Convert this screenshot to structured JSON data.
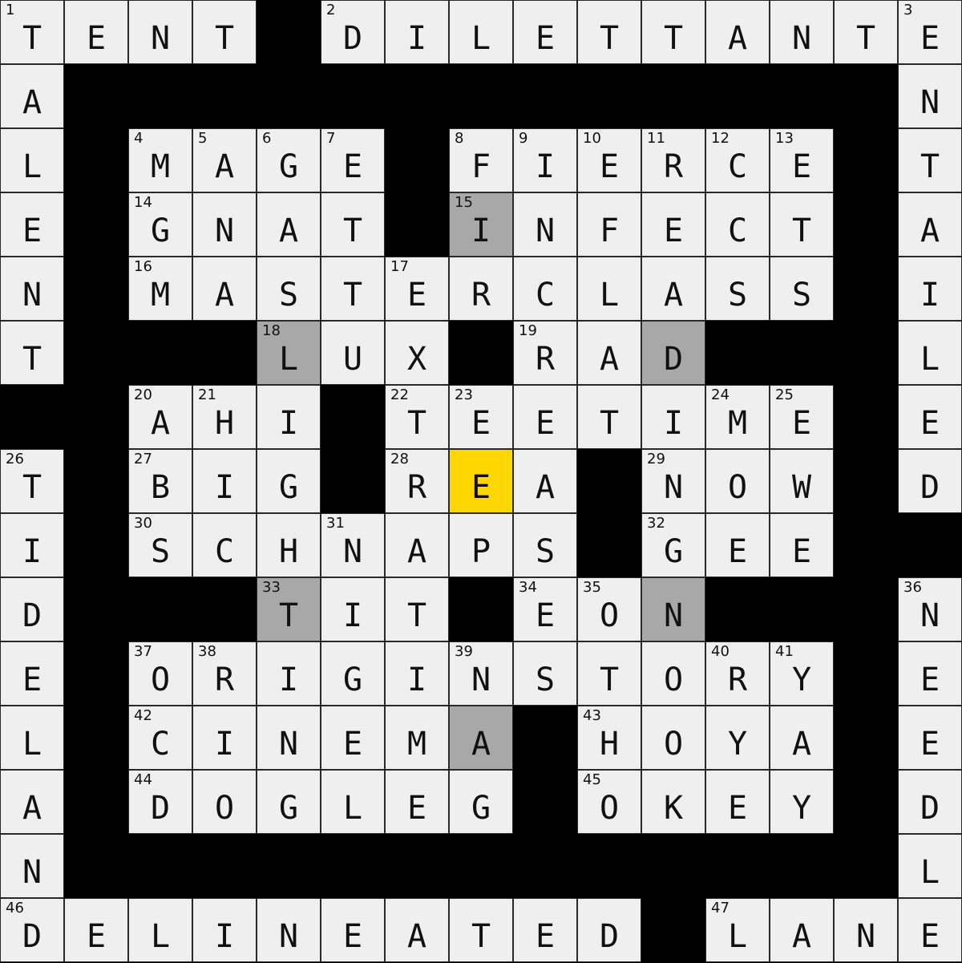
{
  "puzzle": {
    "size": 15,
    "grid": [
      "TENT#DILETTANTE",
      "A#############N",
      "L#MAGE#FIERCE#T",
      "E#GNAT#INFECT#A",
      "N#MASTERCLASS#I",
      "T###LUX#RAD###L",
      "##AHI#TEETIME#E",
      "T#BIG#REA#NOW#D",
      "I#SCHNAPS#GEE##",
      "D###TIT#EON###N",
      "E#ORIGINSTORY#E",
      "L#CINEMA#HOYA#E",
      "A#DOGLEG#OKEY#D",
      "N#############L",
      "DELINEATED#LANE"
    ],
    "numbers": [
      {
        "r": 0,
        "c": 0,
        "n": "1"
      },
      {
        "r": 0,
        "c": 5,
        "n": "2"
      },
      {
        "r": 0,
        "c": 14,
        "n": "3"
      },
      {
        "r": 2,
        "c": 2,
        "n": "4"
      },
      {
        "r": 2,
        "c": 3,
        "n": "5"
      },
      {
        "r": 2,
        "c": 4,
        "n": "6"
      },
      {
        "r": 2,
        "c": 5,
        "n": "7"
      },
      {
        "r": 2,
        "c": 7,
        "n": "8"
      },
      {
        "r": 2,
        "c": 8,
        "n": "9"
      },
      {
        "r": 2,
        "c": 9,
        "n": "10"
      },
      {
        "r": 2,
        "c": 10,
        "n": "11"
      },
      {
        "r": 2,
        "c": 11,
        "n": "12"
      },
      {
        "r": 2,
        "c": 12,
        "n": "13"
      },
      {
        "r": 3,
        "c": 2,
        "n": "14"
      },
      {
        "r": 3,
        "c": 7,
        "n": "15"
      },
      {
        "r": 4,
        "c": 2,
        "n": "16"
      },
      {
        "r": 4,
        "c": 6,
        "n": "17"
      },
      {
        "r": 5,
        "c": 4,
        "n": "18"
      },
      {
        "r": 5,
        "c": 8,
        "n": "19"
      },
      {
        "r": 6,
        "c": 2,
        "n": "20"
      },
      {
        "r": 6,
        "c": 3,
        "n": "21"
      },
      {
        "r": 6,
        "c": 6,
        "n": "22"
      },
      {
        "r": 6,
        "c": 7,
        "n": "23"
      },
      {
        "r": 6,
        "c": 11,
        "n": "24"
      },
      {
        "r": 6,
        "c": 12,
        "n": "25"
      },
      {
        "r": 7,
        "c": 0,
        "n": "26"
      },
      {
        "r": 7,
        "c": 2,
        "n": "27"
      },
      {
        "r": 7,
        "c": 6,
        "n": "28"
      },
      {
        "r": 7,
        "c": 10,
        "n": "29"
      },
      {
        "r": 8,
        "c": 2,
        "n": "30"
      },
      {
        "r": 8,
        "c": 5,
        "n": "31"
      },
      {
        "r": 8,
        "c": 10,
        "n": "32"
      },
      {
        "r": 9,
        "c": 4,
        "n": "33"
      },
      {
        "r": 9,
        "c": 8,
        "n": "34"
      },
      {
        "r": 9,
        "c": 9,
        "n": "35"
      },
      {
        "r": 9,
        "c": 14,
        "n": "36"
      },
      {
        "r": 10,
        "c": 2,
        "n": "37"
      },
      {
        "r": 10,
        "c": 3,
        "n": "38"
      },
      {
        "r": 10,
        "c": 7,
        "n": "39"
      },
      {
        "r": 10,
        "c": 11,
        "n": "40"
      },
      {
        "r": 10,
        "c": 12,
        "n": "41"
      },
      {
        "r": 11,
        "c": 2,
        "n": "42"
      },
      {
        "r": 11,
        "c": 9,
        "n": "43"
      },
      {
        "r": 12,
        "c": 2,
        "n": "44"
      },
      {
        "r": 12,
        "c": 9,
        "n": "45"
      },
      {
        "r": 14,
        "c": 0,
        "n": "46"
      },
      {
        "r": 14,
        "c": 11,
        "n": "47"
      }
    ],
    "shaded": [
      {
        "r": 3,
        "c": 7
      },
      {
        "r": 5,
        "c": 4
      },
      {
        "r": 5,
        "c": 10
      },
      {
        "r": 9,
        "c": 4
      },
      {
        "r": 9,
        "c": 10
      },
      {
        "r": 11,
        "c": 7
      }
    ],
    "active": {
      "r": 7,
      "c": 7
    },
    "colors": {
      "cell": "#efefef",
      "block": "#000000",
      "shaded": "#a8a8a8",
      "active": "#ffd700"
    }
  }
}
